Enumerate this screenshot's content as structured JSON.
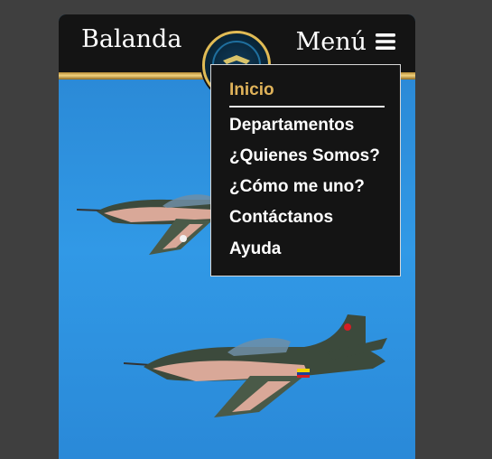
{
  "header": {
    "brand": "Balanda",
    "menu_label": "Menú"
  },
  "icons": {
    "hamburger": "hamburger-icon",
    "emblem": "military-emblem"
  },
  "colors": {
    "page_background": "#3f3f3f",
    "header_background": "#141414",
    "gold_accent": "#e0b35a",
    "sky": "#2c8fd9",
    "menu_text": "#ffffff"
  },
  "nav": {
    "items": [
      {
        "label": "Inicio",
        "active": true
      },
      {
        "label": "Departamentos",
        "active": false
      },
      {
        "label": "¿Quienes Somos?",
        "active": false
      },
      {
        "label": "¿Cómo me uno?",
        "active": false
      },
      {
        "label": "Contáctanos",
        "active": false
      },
      {
        "label": "Ayuda",
        "active": false
      }
    ]
  }
}
